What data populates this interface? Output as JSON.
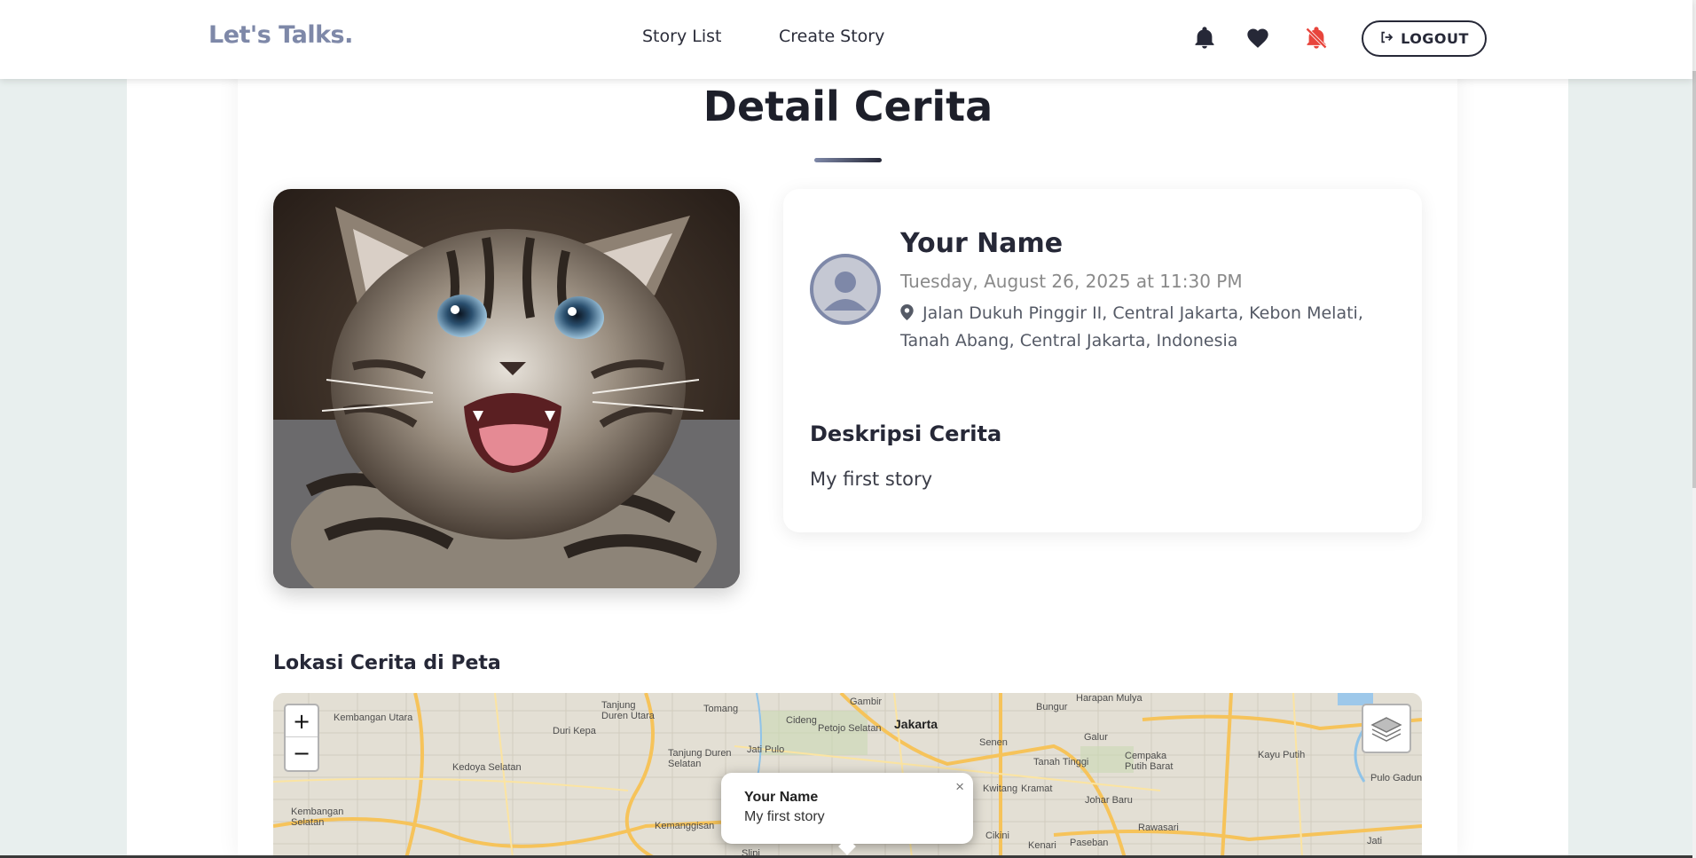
{
  "app": {
    "brand": "Let's Talks."
  },
  "nav": {
    "story_list": "Story List",
    "create_story": "Create Story",
    "logout": "LOGOUT"
  },
  "icons": {
    "bell": "bell-icon",
    "heart": "heart-icon",
    "notifications_off": "bell-slash-icon",
    "logout": "sign-out-icon",
    "location": "map-pin-icon",
    "layers": "layers-icon"
  },
  "colors": {
    "brand": "#7e88a8",
    "dark": "#262837",
    "notif_off": "#e8453c"
  },
  "page": {
    "title": "Detail Cerita"
  },
  "story": {
    "author": "Your Name",
    "date": "Tuesday, August 26, 2025 at 11:30 PM",
    "location": "Jalan Dukuh Pinggir II, Central Jakarta, Kebon Melati, Tanah Abang, Central Jakarta, Indonesia",
    "description_title": "Deskripsi Cerita",
    "description": "My first story"
  },
  "map": {
    "heading": "Lokasi Cerita di Peta",
    "zoom_in": "+",
    "zoom_out": "−",
    "labels": [
      "Kembangan Utara",
      "Tanjung Duren Utara",
      "Tomang",
      "Gambir",
      "Harapan Mulya",
      "Duri Kepa",
      "Cideng",
      "Petojo Selatan",
      "Jakarta",
      "Bungur",
      "Galur",
      "Jati Pulo",
      "Senen",
      "Tanah Tinggi",
      "Cempaka Putih Barat",
      "Kayu Putih",
      "Kedoya Selatan",
      "Tanjung Duren Selatan",
      "Pulo Gadung",
      "Kwitang",
      "Kramat",
      "Johar Baru",
      "Kembangan Selatan",
      "Kemanggisan",
      "Rawasari",
      "Cikini",
      "Kenari",
      "Paseban",
      "Slipi",
      "Jati"
    ],
    "popup": {
      "name": "Your Name",
      "text": "My first story",
      "close": "×"
    }
  }
}
